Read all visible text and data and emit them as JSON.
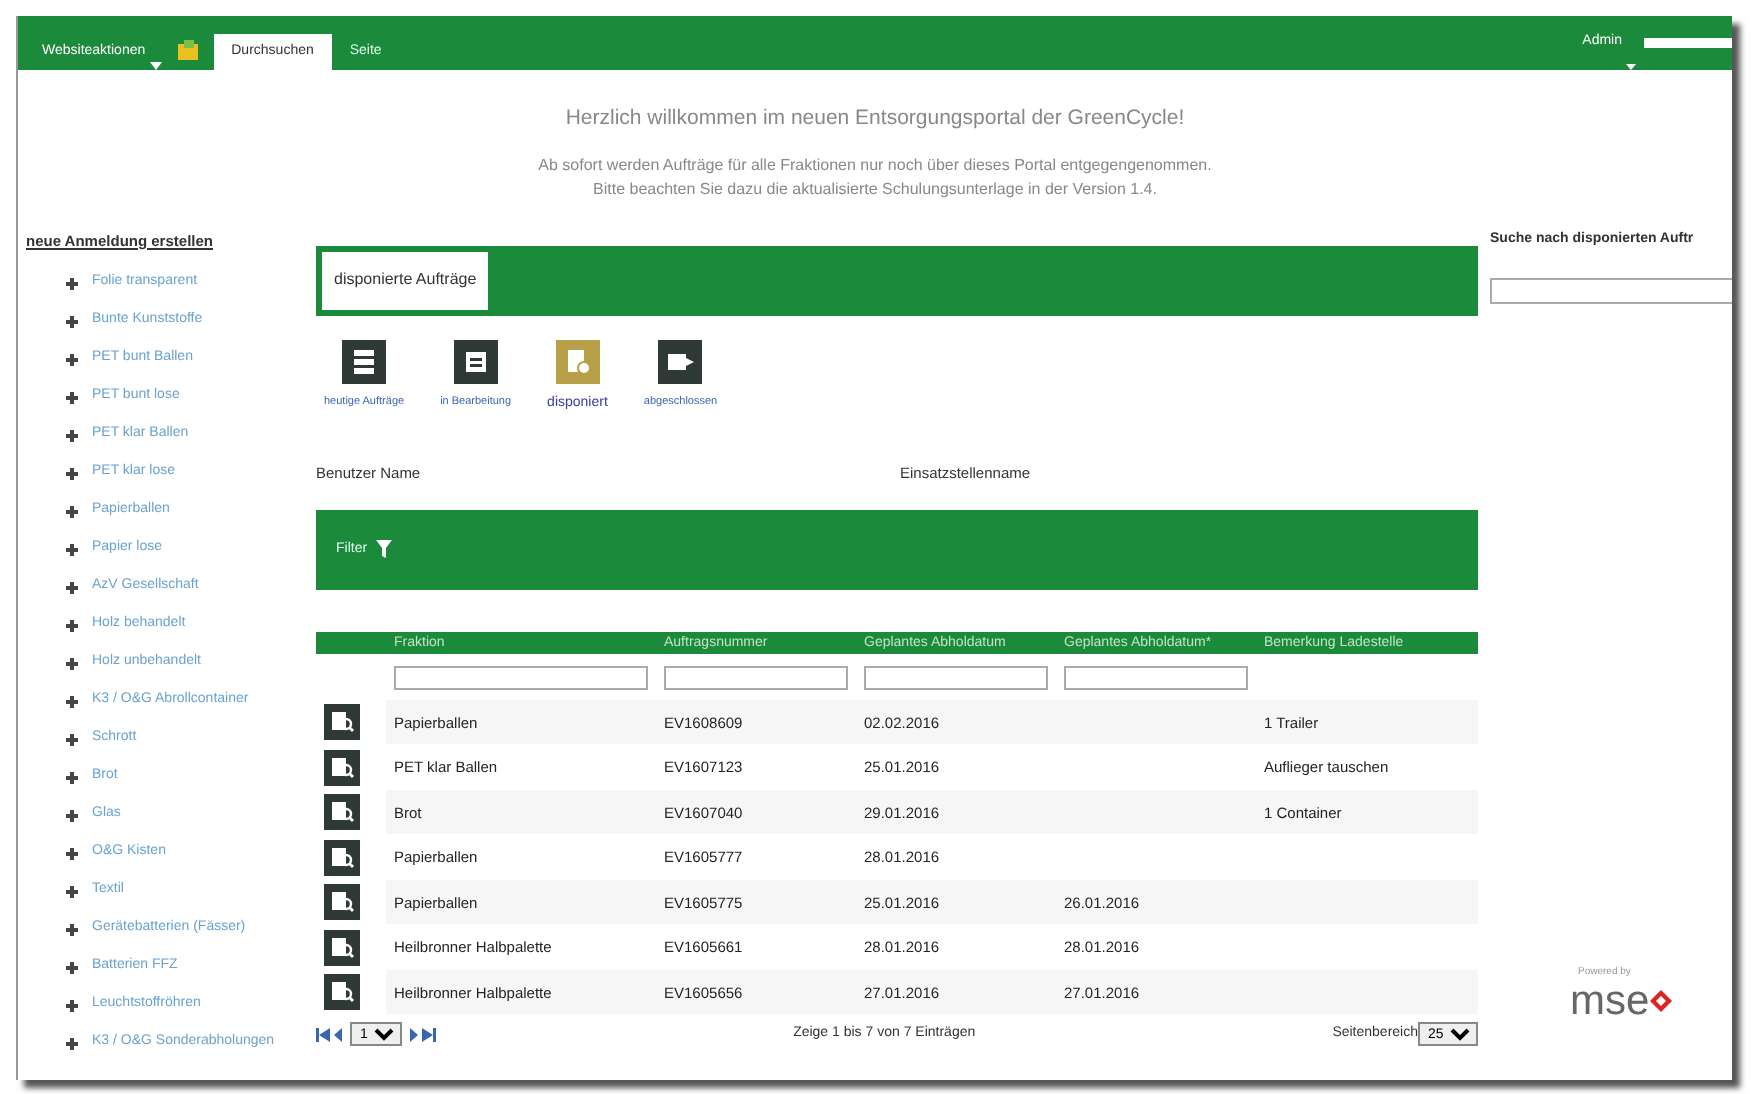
{
  "top_bar": {
    "menu": "Websiteaktionen",
    "tabs": [
      {
        "label": "Durchsuchen",
        "selected": true
      },
      {
        "label": "Seite",
        "selected": false
      }
    ],
    "user": "Admin"
  },
  "welcome": {
    "title": "Herzlich willkommen im neuen Entsorgungsportal der GreenCycle!",
    "lines": [
      "Ab sofort werden Aufträge für alle Fraktionen nur noch über dieses Portal entgegengenommen.",
      "Bitte beachten Sie dazu die aktualisierte Schulungsunterlage in der Version 1.4."
    ]
  },
  "sidebar": {
    "heading": "neue Anmeldung erstellen",
    "items": [
      "Folie transparent",
      "Bunte Kunststoffe",
      "PET bunt Ballen",
      "PET bunt lose",
      "PET klar Ballen",
      "PET klar lose",
      "Papierballen",
      "Papier lose",
      "AzV Gesellschaft",
      "Holz behandelt",
      "Holz unbehandelt",
      "K3 / O&G Abrollcontainer",
      "Schrott",
      "Brot",
      "Glas",
      "O&G Kisten",
      "Textil",
      "Gerätebatterien (Fässer)",
      "Batterien FFZ",
      "Leuchtstoffröhren",
      "K3 / O&G Sonderabholungen"
    ]
  },
  "panel_title": "disponierte Aufträge",
  "views": [
    {
      "label": "heutige Aufträge",
      "selected": false
    },
    {
      "label": "in Bearbeitung",
      "selected": false
    },
    {
      "label": "disponiert",
      "selected": true
    },
    {
      "label": "abgeschlossen",
      "selected": false
    }
  ],
  "info_labels": [
    "Benutzer Name",
    "Einsatzstellenname"
  ],
  "filter": {
    "label": "Filter"
  },
  "table": {
    "columns": [
      "Fraktion",
      "Auftragsnummer",
      "Geplantes Abholdatum",
      "Geplantes Abholdatum*",
      "Bemerkung Ladestelle"
    ],
    "rows": [
      [
        "Papierballen",
        "EV1608609",
        "02.02.2016",
        "",
        "1 Trailer"
      ],
      [
        "PET klar Ballen",
        "EV1607123",
        "25.01.2016",
        "",
        "Auflieger tauschen"
      ],
      [
        "Brot",
        "EV1607040",
        "29.01.2016",
        "",
        "1 Container"
      ],
      [
        "Papierballen",
        "EV1605777",
        "28.01.2016",
        "",
        ""
      ],
      [
        "Papierballen",
        "EV1605775",
        "25.01.2016",
        "26.01.2016",
        ""
      ],
      [
        "Heilbronner Halbpalette",
        "EV1605661",
        "28.01.2016",
        "28.01.2016",
        ""
      ],
      [
        "Heilbronner Halbpalette",
        "EV1605656",
        "27.01.2016",
        "27.01.2016",
        ""
      ]
    ]
  },
  "pagination": {
    "page": "1",
    "summary": "Zeige 1 bis 7 von 7 Einträgen",
    "page_size_label": "Seitenbereich",
    "page_size": "25"
  },
  "search": {
    "label": "Suche nach disponierten Auftr"
  },
  "branding": {
    "powered_by": "Powered by",
    "logo": "mse"
  }
}
